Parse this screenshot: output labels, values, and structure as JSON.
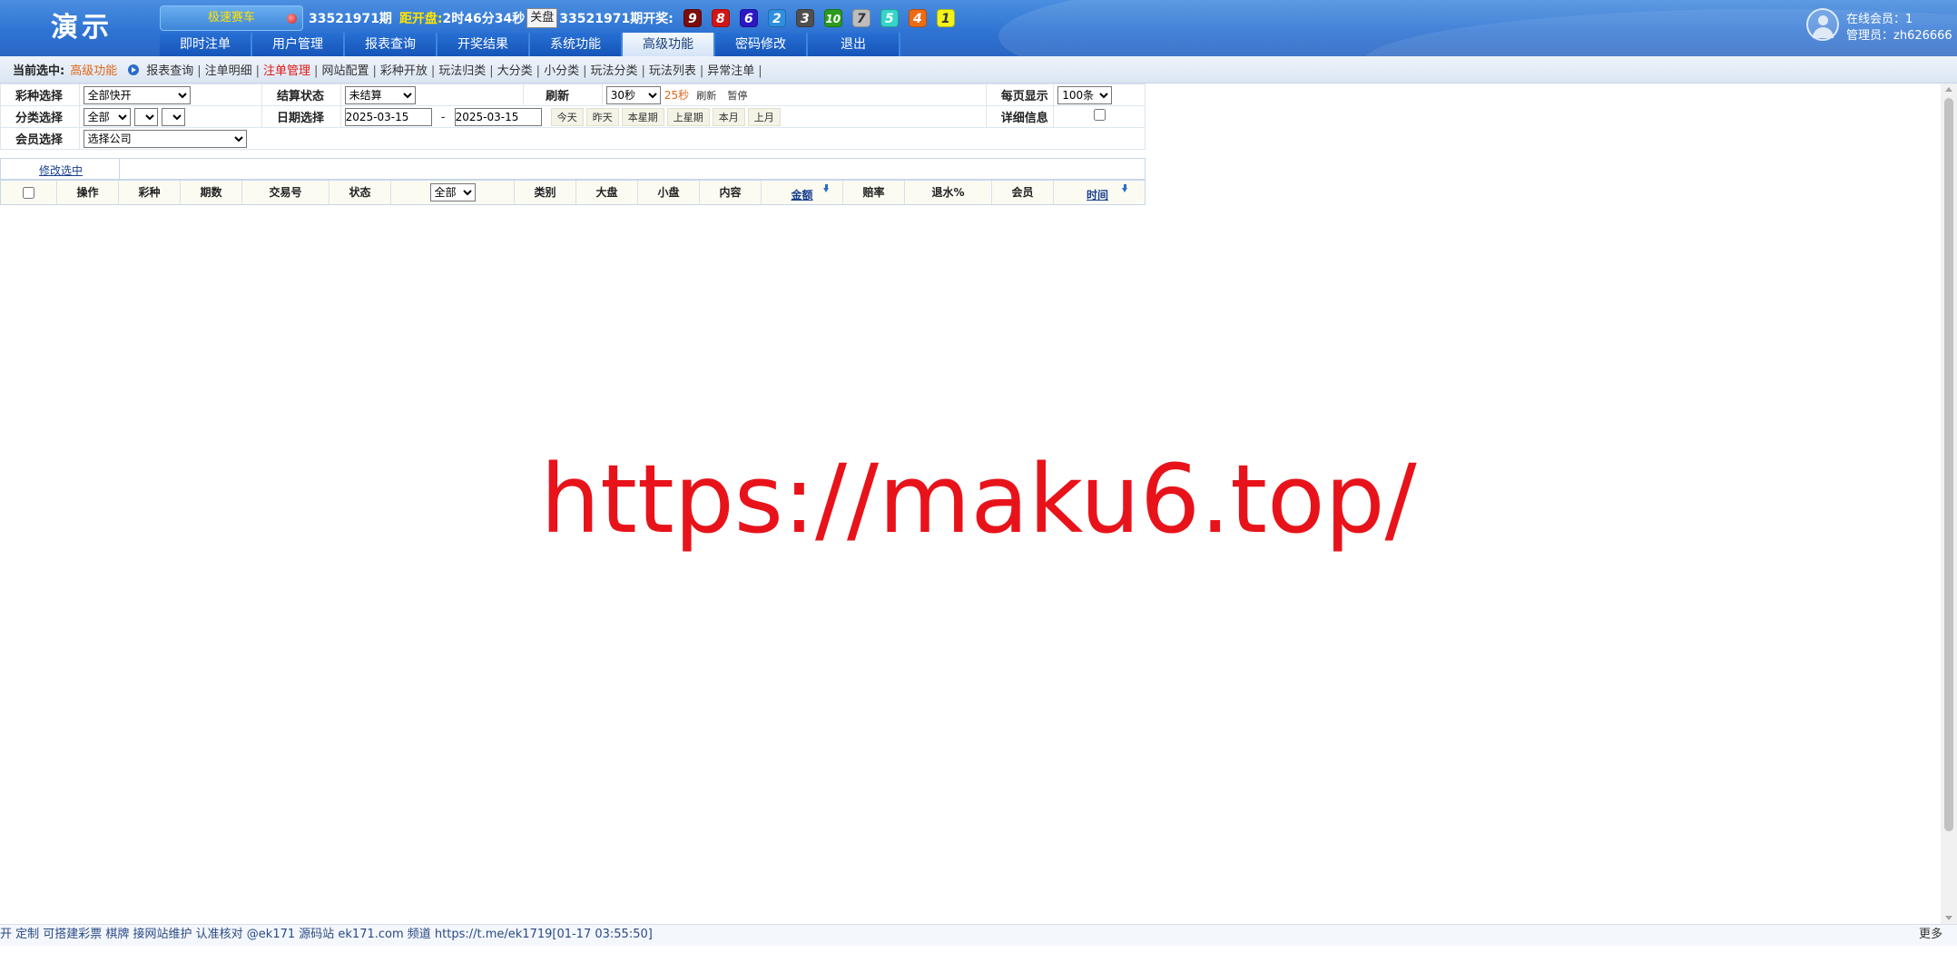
{
  "header": {
    "logo": "演示",
    "lottery_name": "极速赛车",
    "current_period": "33521971期",
    "countdown_label": "距开盘:",
    "countdown": "2时46分34秒",
    "close_button": "关盘",
    "draw_period": "33521971期开奖:",
    "balls": [
      {
        "num": "9",
        "color": "#7a0d0d",
        "text": "#ffffff"
      },
      {
        "num": "8",
        "color": "#d11616",
        "text": "#ffffff"
      },
      {
        "num": "6",
        "color": "#2b18c4",
        "text": "#ffffff"
      },
      {
        "num": "2",
        "color": "#2e8fe0",
        "text": "#ffffff"
      },
      {
        "num": "3",
        "color": "#505050",
        "text": "#ffffff"
      },
      {
        "num": "10",
        "color": "#2c9a1f",
        "text": "#ffffff"
      },
      {
        "num": "7",
        "color": "#bdbdbd",
        "text": "#333333"
      },
      {
        "num": "5",
        "color": "#36d4c9",
        "text": "#ffffff"
      },
      {
        "num": "4",
        "color": "#ee6b15",
        "text": "#ffffff"
      },
      {
        "num": "1",
        "color": "#f3f31a",
        "text": "#333333"
      }
    ],
    "nav_tabs": [
      {
        "label": "即时注单",
        "active": false
      },
      {
        "label": "用户管理",
        "active": false
      },
      {
        "label": "报表查询",
        "active": false
      },
      {
        "label": "开奖结果",
        "active": false
      },
      {
        "label": "系统功能",
        "active": false
      },
      {
        "label": "高级功能",
        "active": true
      },
      {
        "label": "密码修改",
        "active": false
      },
      {
        "label": "退出",
        "active": false
      }
    ],
    "user": {
      "online": "在线会员：1",
      "admin": "管理员：zh626666"
    }
  },
  "sub_nav": {
    "current_label": "当前选中:",
    "current_value": "高级功能",
    "links": [
      {
        "label": "报表查询",
        "active": false
      },
      {
        "label": "注单明细",
        "active": false
      },
      {
        "label": "注单管理",
        "active": true
      },
      {
        "label": "网站配置",
        "active": false
      },
      {
        "label": "彩种开放",
        "active": false
      },
      {
        "label": "玩法归类",
        "active": false
      },
      {
        "label": "大分类",
        "active": false
      },
      {
        "label": "小分类",
        "active": false
      },
      {
        "label": "玩法分类",
        "active": false
      },
      {
        "label": "玩法列表",
        "active": false
      },
      {
        "label": "异常注单",
        "active": false
      }
    ]
  },
  "filters": {
    "lottery_label": "彩种选择",
    "lottery_value": "全部快开",
    "settle_label": "结算状态",
    "settle_value": "未结算",
    "refresh_label": "刷新",
    "refresh_value": "30秒",
    "refresh_seconds": "25秒",
    "refresh_link": "刷新",
    "pause_link": "暂停",
    "per_page_label": "每页显示",
    "per_page_value": "100条",
    "category_label": "分类选择",
    "category_value": "全部",
    "date_label": "日期选择",
    "date_from": "2025-03-15",
    "date_sep": "-",
    "date_to": "2025-03-15",
    "quick_dates": [
      "今天",
      "昨天",
      "本星期",
      "上星期",
      "本月",
      "上月"
    ],
    "detail_label": "详细信息",
    "member_label": "会员选择",
    "member_value": "选择公司"
  },
  "results": {
    "edit_selected": "修改选中",
    "columns": [
      "操作",
      "彩种",
      "期数",
      "交易号",
      "状态",
      "全部",
      "类别",
      "大盘",
      "小盘",
      "内容",
      "金额",
      "赔率",
      "退水%",
      "会员",
      "时间"
    ]
  },
  "watermark": "https://maku6.top/",
  "footer": {
    "ticker": "开 定制 可搭建彩票 棋牌 接网站维护 认准核对 @ek171 源码站 ek171.com 频道 https://t.me/ek1719[01-17 03:55:50]",
    "more": "更多"
  }
}
